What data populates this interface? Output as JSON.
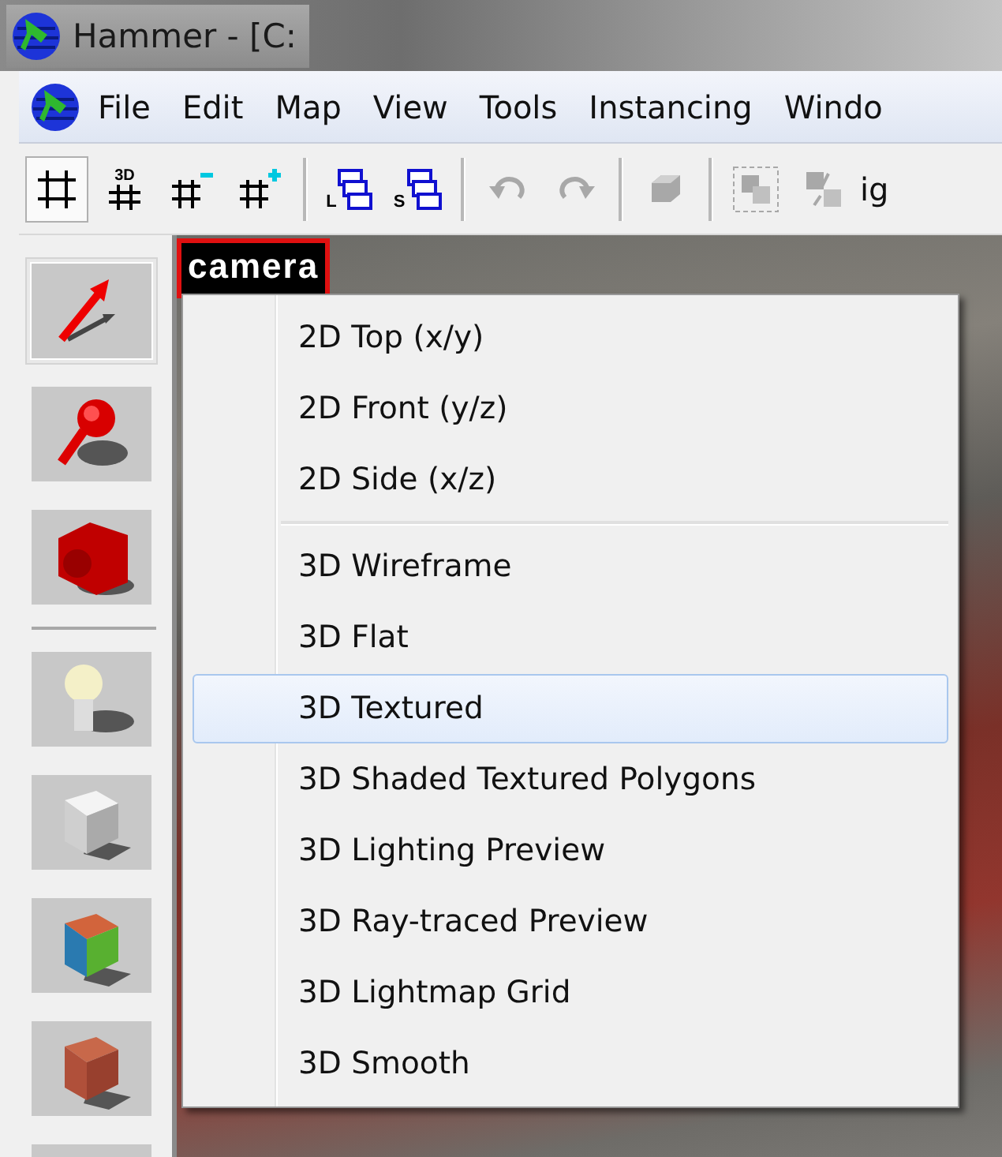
{
  "window": {
    "title": "Hammer - [C:"
  },
  "menu_bar": {
    "items": [
      {
        "label": "File"
      },
      {
        "label": "Edit"
      },
      {
        "label": "Map"
      },
      {
        "label": "View"
      },
      {
        "label": "Tools"
      },
      {
        "label": "Instancing"
      },
      {
        "label": "Windo"
      }
    ]
  },
  "toolbar": {
    "items": [
      {
        "kind": "grid",
        "pressed": true,
        "disabled": false
      },
      {
        "kind": "grid-3d",
        "label": "3D",
        "pressed": false,
        "disabled": false
      },
      {
        "kind": "grid-minus",
        "pressed": false,
        "disabled": false
      },
      {
        "kind": "grid-plus",
        "pressed": false,
        "disabled": false
      },
      {
        "kind": "separator"
      },
      {
        "kind": "stack",
        "label": "L",
        "pressed": false,
        "disabled": false
      },
      {
        "kind": "stack",
        "label": "S",
        "pressed": false,
        "disabled": false
      },
      {
        "kind": "separator"
      },
      {
        "kind": "undo",
        "pressed": false,
        "disabled": true
      },
      {
        "kind": "redo",
        "pressed": false,
        "disabled": true
      },
      {
        "kind": "separator"
      },
      {
        "kind": "cube",
        "pressed": false,
        "disabled": true
      },
      {
        "kind": "separator"
      },
      {
        "kind": "group",
        "pressed": false,
        "disabled": true
      },
      {
        "kind": "ungroup",
        "pressed": false,
        "disabled": true
      },
      {
        "kind": "text",
        "label": "ig"
      }
    ]
  },
  "tools": [
    {
      "kind": "pointer",
      "selected": true
    },
    {
      "kind": "magnifier",
      "selected": false
    },
    {
      "kind": "camera",
      "selected": false
    },
    {
      "kind": "separator"
    },
    {
      "kind": "light",
      "selected": false
    },
    {
      "kind": "cube",
      "selected": false
    },
    {
      "kind": "textured-cube",
      "selected": false
    },
    {
      "kind": "brick-cube",
      "selected": false
    },
    {
      "kind": "partial",
      "selected": false
    }
  ],
  "viewport": {
    "view_label": "camera"
  },
  "view_menu": {
    "items": [
      {
        "kind": "item",
        "label": "2D Top (x/y)",
        "selected": false
      },
      {
        "kind": "item",
        "label": "2D Front (y/z)",
        "selected": false
      },
      {
        "kind": "item",
        "label": "2D Side (x/z)",
        "selected": false
      },
      {
        "kind": "separator"
      },
      {
        "kind": "item",
        "label": "3D Wireframe",
        "selected": false
      },
      {
        "kind": "item",
        "label": "3D Flat",
        "selected": false
      },
      {
        "kind": "item",
        "label": "3D Textured",
        "selected": true
      },
      {
        "kind": "item",
        "label": "3D Shaded Textured Polygons",
        "selected": false
      },
      {
        "kind": "item",
        "label": "3D Lighting Preview",
        "selected": false
      },
      {
        "kind": "item",
        "label": "3D Ray-traced Preview",
        "selected": false
      },
      {
        "kind": "item",
        "label": "3D Lightmap Grid",
        "selected": false
      },
      {
        "kind": "item",
        "label": "3D Smooth",
        "selected": false
      }
    ]
  }
}
